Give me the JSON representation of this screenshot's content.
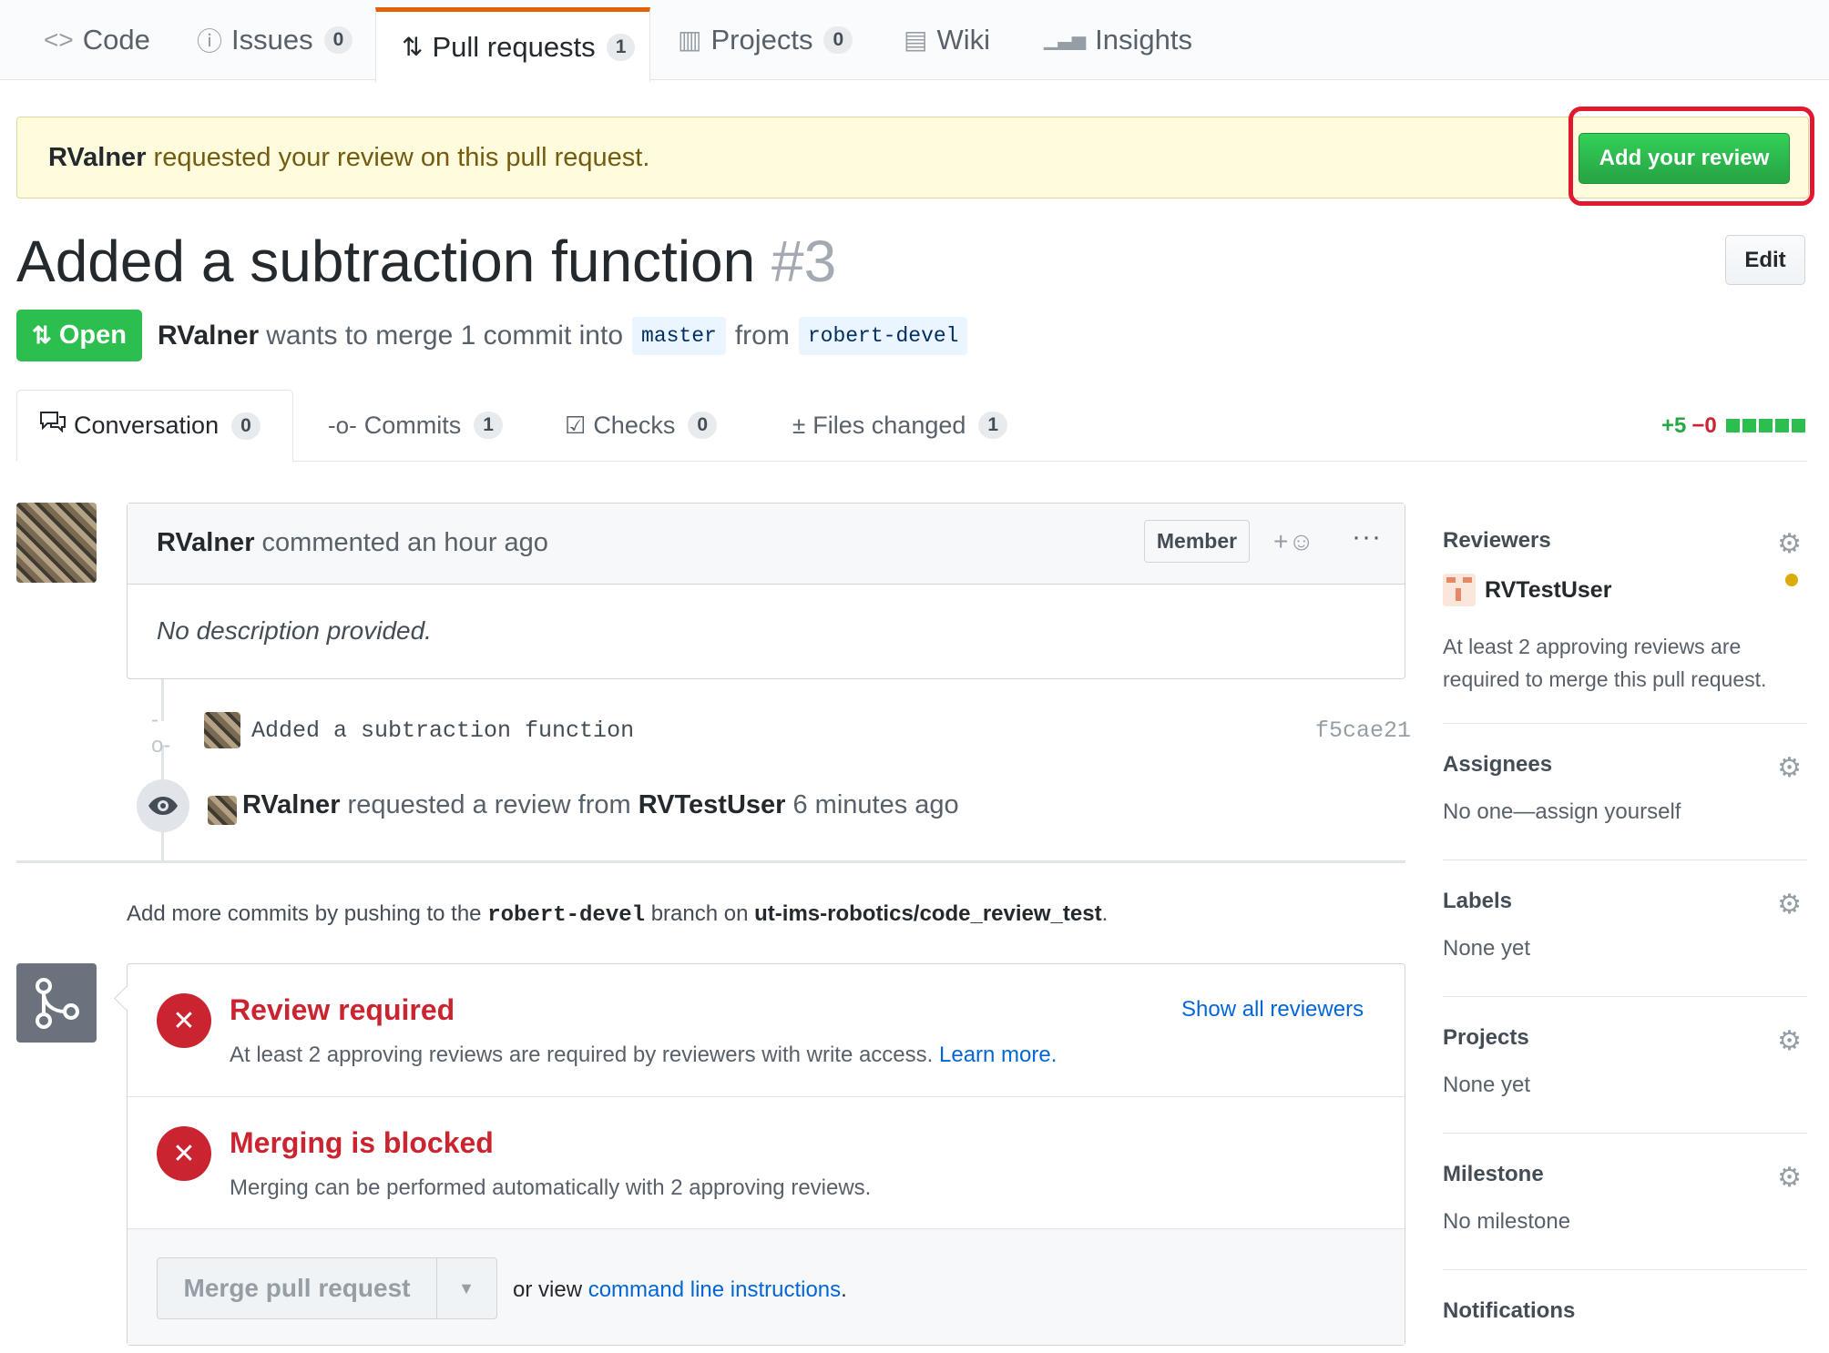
{
  "repo_tabs": [
    {
      "icon": "code-icon",
      "glyph": "<>",
      "label": "Code",
      "count": ""
    },
    {
      "icon": "issue-icon",
      "glyph": "ⓘ",
      "label": "Issues",
      "count": "0"
    },
    {
      "icon": "pull-request-icon",
      "glyph": "⇅",
      "label": "Pull requests",
      "count": "1"
    },
    {
      "icon": "project-icon",
      "glyph": "▥",
      "label": "Projects",
      "count": "0"
    },
    {
      "icon": "wiki-icon",
      "glyph": "▤",
      "label": "Wiki",
      "count": ""
    },
    {
      "icon": "graph-icon",
      "glyph": "▁▃▅",
      "label": "Insights",
      "count": ""
    }
  ],
  "banner": {
    "user": "RValner",
    "text": "requested your review on this pull request.",
    "button": "Add your review"
  },
  "pr": {
    "title": "Added a subtraction function",
    "number": "#3",
    "edit": "Edit",
    "state": "Open",
    "author": "RValner",
    "merge_text": "wants to merge 1 commit into",
    "base": "master",
    "from": "from",
    "head": "robert-devel"
  },
  "pr_tabs": [
    {
      "icon": "comment-discussion-icon",
      "glyph": "💬",
      "label": "Conversation",
      "count": "0"
    },
    {
      "icon": "git-commit-icon",
      "glyph": "-o-",
      "label": "Commits",
      "count": "1"
    },
    {
      "icon": "checklist-icon",
      "glyph": "☑",
      "label": "Checks",
      "count": "0"
    },
    {
      "icon": "file-diff-icon",
      "glyph": "±",
      "label": "Files changed",
      "count": "1"
    }
  ],
  "diffstat": {
    "additions": "+5",
    "deletions": "−0",
    "blocks_added": 5
  },
  "comment": {
    "author": "RValner",
    "when": "commented an hour ago",
    "badge": "Member",
    "more": "···",
    "body": "No description provided."
  },
  "timeline": {
    "commit_message": "Added a subtraction function",
    "commit_sha": "f5cae21",
    "event_actor": "RValner",
    "event_text": "requested a review from",
    "event_target": "RVTestUser",
    "event_time": "6 minutes ago"
  },
  "hint": {
    "pre": "Add more commits by pushing to the",
    "branch": "robert-devel",
    "mid": "branch on",
    "repo": "ut-ims-robotics/code_review_test",
    "end": "."
  },
  "merge": {
    "review_title": "Review required",
    "review_desc": "At least 2 approving reviews are required by reviewers with write access.",
    "learn_more": "Learn more.",
    "show_reviewers": "Show all reviewers",
    "blocked_title": "Merging is blocked",
    "blocked_desc": "Merging can be performed automatically with 2 approving reviews.",
    "button": "Merge pull request",
    "or_view": "or view",
    "cli_link": "command line instructions",
    "period": "."
  },
  "sidebar": {
    "reviewers_title": "Reviewers",
    "reviewer": "RVTestUser",
    "reviewers_note": "At least 2 approving reviews are required to merge this pull request.",
    "assignees_title": "Assignees",
    "assignees_value": "No one—assign yourself",
    "labels_title": "Labels",
    "labels_value": "None yet",
    "projects_title": "Projects",
    "projects_value": "None yet",
    "milestone_title": "Milestone",
    "milestone_value": "No milestone",
    "notifications_title": "Notifications"
  },
  "colors": {
    "accent_green": "#28a745",
    "error_red": "#cb2431",
    "link_blue": "#0366d6",
    "highlight_outline": "#e0192f"
  }
}
